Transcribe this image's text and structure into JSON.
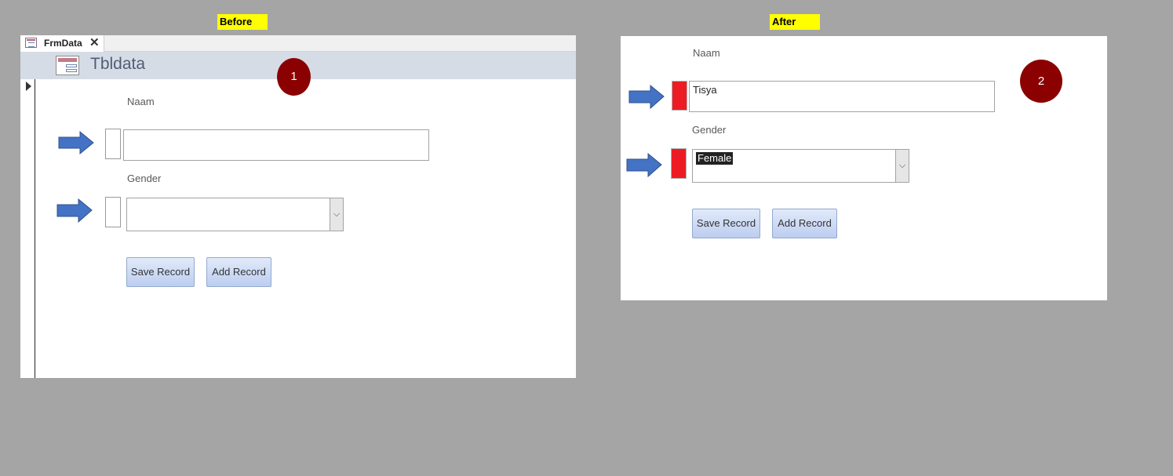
{
  "labels": {
    "before": "Before",
    "after": "After"
  },
  "before": {
    "tab_title": "FrmData",
    "form_title": "Tbldata",
    "callout": "1",
    "naam_label": "Naam",
    "naam_value": "",
    "gender_label": "Gender",
    "gender_value": "",
    "save_label": "Save Record",
    "add_label": "Add Record"
  },
  "after": {
    "callout": "2",
    "naam_label": "Naam",
    "naam_value": "Tisya",
    "gender_label": "Gender",
    "gender_value": "Female",
    "save_label": "Save Record",
    "add_label": "Add Record",
    "indicator_color": "#ED1C24"
  },
  "colors": {
    "background": "#A5A5A5",
    "label_highlight": "#FFFF00",
    "callout_circle": "#8B0000",
    "arrow_fill": "#4472C4",
    "header_band": "#D6DCE6"
  },
  "icons": [
    "form-icon",
    "close-icon",
    "record-selector-icon",
    "chevron-down-icon",
    "right-arrow-icon"
  ]
}
